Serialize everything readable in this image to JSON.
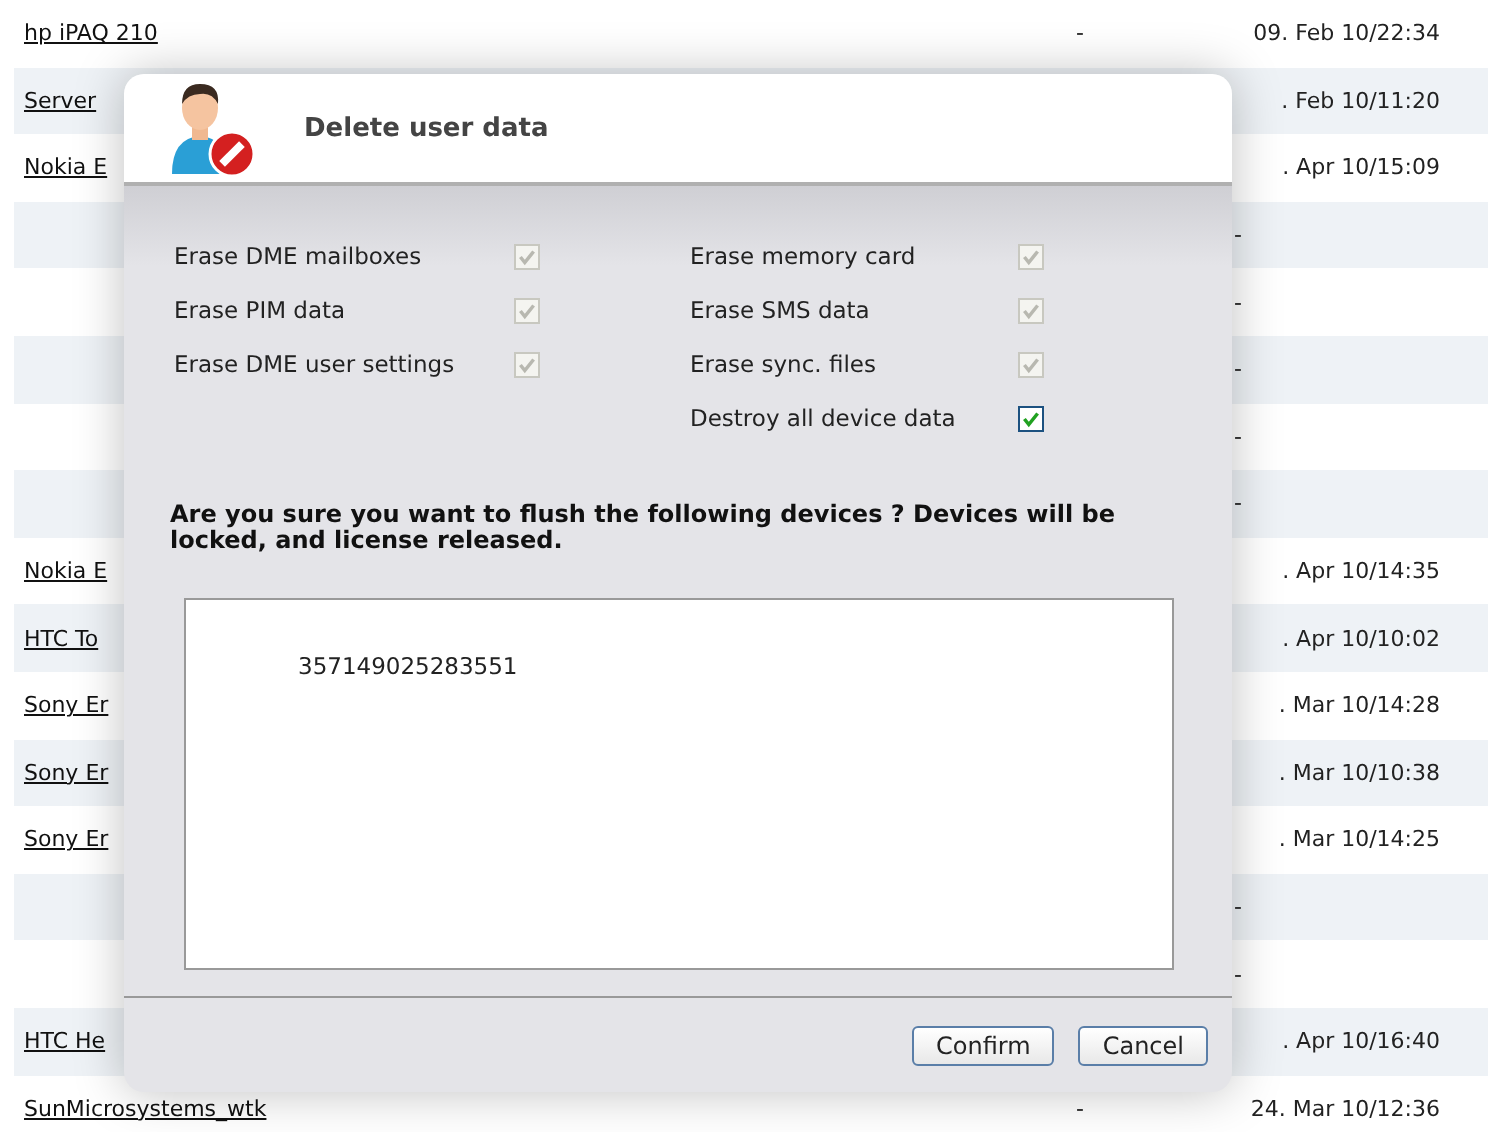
{
  "devices": [
    {
      "name": "hp iPAQ 210",
      "column_2": "-",
      "last_sync": "09. Feb 10/22:34",
      "kind": "dated"
    },
    {
      "name": "Server",
      "last_sync": ". Feb 10/11:20",
      "kind": "dated"
    },
    {
      "name": "Nokia E",
      "last_sync": ". Apr 10/15:09",
      "kind": "dated"
    },
    {
      "last_sync": "-",
      "kind": "undated"
    },
    {
      "last_sync": "-",
      "kind": "undated"
    },
    {
      "last_sync": "-",
      "kind": "undated"
    },
    {
      "last_sync": "-",
      "kind": "undated"
    },
    {
      "last_sync": "-",
      "kind": "undated"
    },
    {
      "name": "Nokia E",
      "last_sync": ". Apr 10/14:35",
      "kind": "dated"
    },
    {
      "name": "HTC To",
      "last_sync": ". Apr 10/10:02",
      "kind": "dated"
    },
    {
      "name": "Sony Er",
      "last_sync": ". Mar 10/14:28",
      "kind": "dated"
    },
    {
      "name": "Sony Er",
      "last_sync": ". Mar 10/10:38",
      "kind": "dated"
    },
    {
      "name": "Sony Er",
      "last_sync": ". Mar 10/14:25",
      "kind": "dated"
    },
    {
      "last_sync": "-",
      "kind": "undated"
    },
    {
      "last_sync": "-",
      "kind": "undated"
    },
    {
      "name": "HTC He",
      "last_sync": ". Apr 10/16:40",
      "kind": "dated"
    },
    {
      "name": "SunMicrosystems_wtk",
      "column_2": "-",
      "last_sync": "24. Mar 10/12:36",
      "kind": "dated"
    }
  ],
  "dialog": {
    "title": "Delete user data",
    "options_left": [
      {
        "label": "Erase DME mailboxes",
        "checked": true,
        "disabled": true
      },
      {
        "label": "Erase PIM data",
        "checked": true,
        "disabled": true
      },
      {
        "label": "Erase DME user settings",
        "checked": true,
        "disabled": true
      }
    ],
    "options_right": [
      {
        "label": "Erase memory card",
        "checked": true,
        "disabled": true
      },
      {
        "label": "Erase SMS data",
        "checked": true,
        "disabled": true
      },
      {
        "label": "Erase sync. files",
        "checked": true,
        "disabled": true
      },
      {
        "label": "Destroy all device data",
        "checked": true,
        "disabled": false
      }
    ],
    "question": "Are you sure you want to flush the following devices ? Devices will be locked, and license released.",
    "devices": [
      "357149025283551"
    ],
    "buttons": [
      "Confirm",
      "Cancel"
    ]
  }
}
